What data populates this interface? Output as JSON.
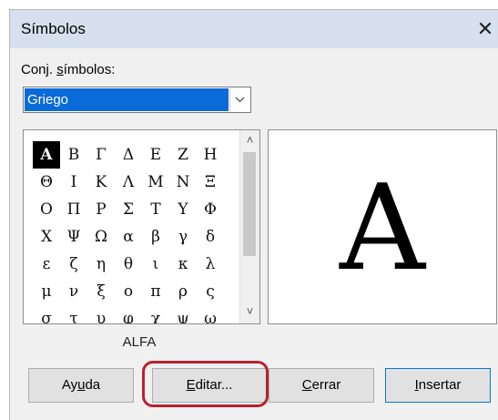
{
  "window": {
    "title": "Símbolos",
    "close_glyph": "✕"
  },
  "symbol_set": {
    "label_prefix": "Conj. ",
    "label_underlined": "s",
    "label_suffix": "ímbolos:",
    "selected_value": "Griego"
  },
  "symbol_grid": {
    "rows": [
      [
        "Α",
        "Β",
        "Γ",
        "Δ",
        "Ε",
        "Ζ",
        "Η"
      ],
      [
        "Θ",
        "Ι",
        "Κ",
        "Λ",
        "Μ",
        "Ν",
        "Ξ"
      ],
      [
        "Ο",
        "Π",
        "Ρ",
        "Σ",
        "Τ",
        "Υ",
        "Φ"
      ],
      [
        "Χ",
        "Ψ",
        "Ω",
        "α",
        "β",
        "γ",
        "δ"
      ],
      [
        "ε",
        "ζ",
        "η",
        "θ",
        "ι",
        "κ",
        "λ"
      ],
      [
        "μ",
        "ν",
        "ξ",
        "ο",
        "π",
        "ρ",
        "ς"
      ],
      [
        "σ",
        "τ",
        "υ",
        "φ",
        "χ",
        "ψ",
        "ω"
      ]
    ],
    "selected": "Α",
    "scroll_up": "˄",
    "scroll_down": "˅"
  },
  "preview": {
    "glyph": "A",
    "name": "ALFA"
  },
  "buttons": {
    "help": {
      "pre": "Ay",
      "u": "u",
      "post": "da"
    },
    "edit": {
      "pre": "",
      "u": "E",
      "post": "ditar..."
    },
    "close": {
      "pre": "",
      "u": "C",
      "post": "errar"
    },
    "insert": {
      "pre": "",
      "u": "I",
      "post": "nsertar"
    }
  }
}
